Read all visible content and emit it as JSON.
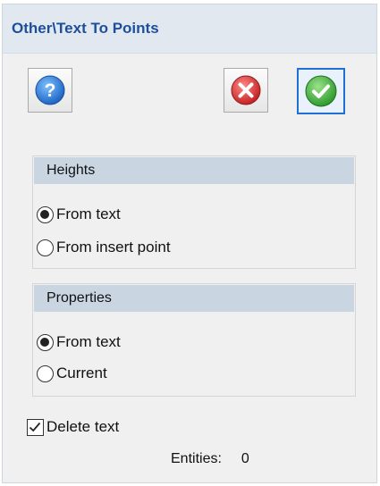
{
  "window": {
    "title": "Other\\Text To Points"
  },
  "toolbar": {
    "help_icon": "question-icon",
    "cancel_icon": "close-icon",
    "ok_icon": "checkmark-icon"
  },
  "heights": {
    "header": "Heights",
    "options": [
      "From text",
      "From insert point"
    ],
    "selected": "From text"
  },
  "properties": {
    "header": "Properties",
    "options": [
      "From text",
      "Current"
    ],
    "selected": "From text"
  },
  "delete_text": {
    "label": "Delete text",
    "checked": true
  },
  "status": {
    "entities_label": "Entities:",
    "entities_value": "0"
  },
  "colors": {
    "title": "#1e4f9b",
    "header_bg": "#cad5e2",
    "help_button": "#2b7fd4",
    "cancel_button": "#d43a3a",
    "ok_button": "#3cae3c",
    "focus_border": "#1f6fd6"
  }
}
